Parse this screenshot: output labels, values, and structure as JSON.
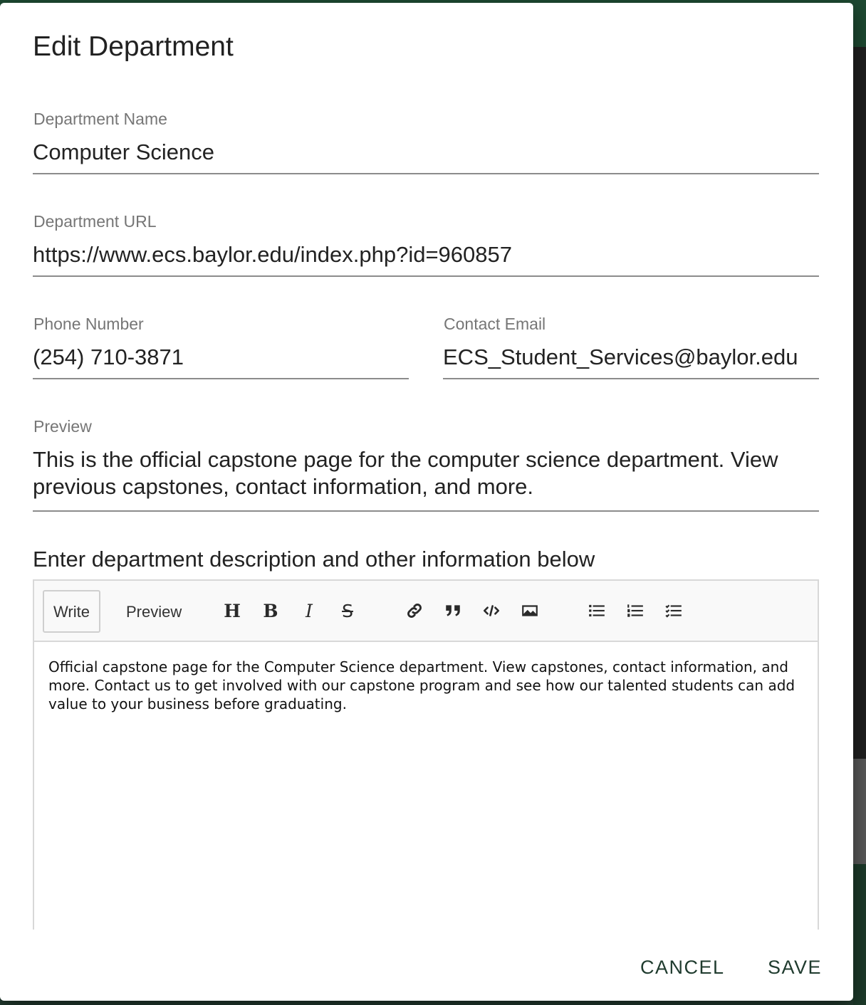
{
  "dialog": {
    "title": "Edit Department",
    "fields": {
      "name": {
        "label": "Department Name",
        "value": "Computer Science"
      },
      "url": {
        "label": "Department URL",
        "value": "https://www.ecs.baylor.edu/index.php?id=960857"
      },
      "phone": {
        "label": "Phone Number",
        "value": "(254) 710-3871"
      },
      "email": {
        "label": "Contact Email",
        "value": "ECS_Student_Services@baylor.edu"
      },
      "preview": {
        "label": "Preview",
        "value": "This is the official capstone page for the computer science department. View previous capstones, contact information, and more."
      }
    },
    "description_label": "Enter department description and other information below",
    "editor": {
      "tabs": {
        "write": "Write",
        "preview": "Preview"
      },
      "active_tab": "Write",
      "tools": [
        "heading-icon",
        "bold-icon",
        "italic-icon",
        "strikethrough-icon",
        "link-icon",
        "quote-icon",
        "code-icon",
        "image-icon",
        "unordered-list-icon",
        "ordered-list-icon",
        "task-list-icon"
      ],
      "content": "Official capstone page for the Computer Science department. View capstones, contact information, and more. Contact us to get involved with our capstone program and see how our talented students can add value to your business before graduating."
    },
    "actions": {
      "cancel": "CANCEL",
      "save": "SAVE"
    }
  },
  "colors": {
    "accent": "#1f3b2e",
    "backdrop": "#243e31"
  }
}
